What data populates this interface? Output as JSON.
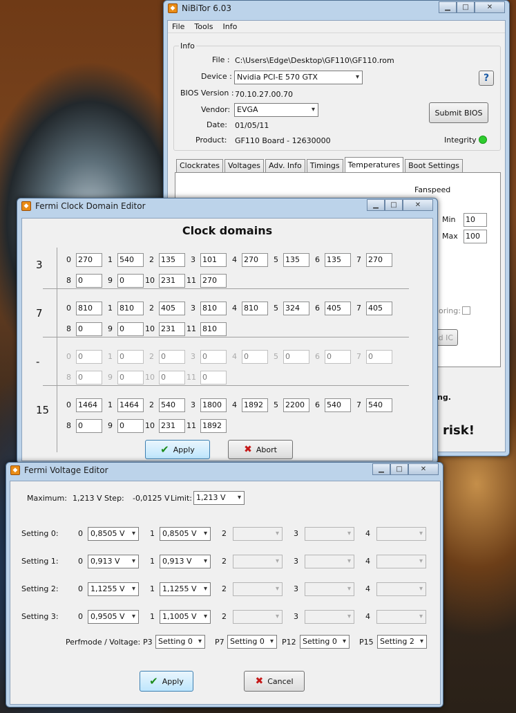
{
  "nibitor": {
    "title": "NiBiTor 6.03",
    "menu": [
      "File",
      "Tools",
      "Info"
    ],
    "info_group": "Info",
    "file_label": "File :",
    "file_value": "C:\\Users\\Edge\\Desktop\\GF110\\GF110.rom",
    "device_label": "Device :",
    "device_value": "Nvidia PCI-E 570 GTX",
    "help_icon": "?",
    "bios_label": "BIOS Version :",
    "bios_value": "70.10.27.00.70",
    "vendor_label": "Vendor:",
    "vendor_value": "EVGA",
    "submit_bios": "Submit BIOS",
    "date_label": "Date:",
    "date_value": "01/05/11",
    "product_label": "Product:",
    "product_value": "GF110 Board - 12630000",
    "integrity_label": "Integrity :",
    "integrity_color": "#2ecc2e",
    "tabs": [
      "Clockrates",
      "Voltages",
      "Adv. Info",
      "Timings",
      "Temperatures",
      "Boot Settings"
    ],
    "fanspeed": "Fanspeed",
    "min_label": "Min",
    "min_value": "10",
    "max_label": "Max",
    "max_value": "100",
    "monitoring_partial": "oring:",
    "ic_partial": "d IC",
    "ng_partial": "ng.",
    "risk_partial": "risk!"
  },
  "clock": {
    "title": "Fermi Clock Domain Editor",
    "heading": "Clock domains",
    "rows": [
      {
        "label": "3",
        "enabled": true,
        "values": [
          "270",
          "540",
          "135",
          "101",
          "270",
          "135",
          "135",
          "270",
          "0",
          "0",
          "231",
          "270"
        ]
      },
      {
        "label": "7",
        "enabled": true,
        "values": [
          "810",
          "810",
          "405",
          "810",
          "810",
          "324",
          "405",
          "405",
          "0",
          "0",
          "231",
          "810"
        ]
      },
      {
        "label": "-",
        "enabled": false,
        "values": [
          "0",
          "0",
          "0",
          "0",
          "0",
          "0",
          "0",
          "0",
          "0",
          "0",
          "0",
          "0"
        ]
      },
      {
        "label": "15",
        "enabled": true,
        "values": [
          "1464",
          "1464",
          "540",
          "1800",
          "1892",
          "2200",
          "540",
          "540",
          "0",
          "0",
          "231",
          "1892"
        ]
      }
    ],
    "indices": [
      "0",
      "1",
      "2",
      "3",
      "4",
      "5",
      "6",
      "7",
      "8",
      "9",
      "10",
      "11"
    ],
    "apply": "Apply",
    "abort": "Abort"
  },
  "voltage": {
    "title": "Fermi Voltage Editor",
    "maximum_label": "Maximum:",
    "maximum_value": "1,213 V",
    "step_label": "Step:",
    "step_value": "-0,0125 V",
    "limit_label": "Limit:",
    "limit_value": "1,213 V",
    "settings": [
      {
        "label": "Setting 0:",
        "v0": "0,8505 V",
        "v1": "0,8505 V"
      },
      {
        "label": "Setting 1:",
        "v0": "0,913 V",
        "v1": "0,913 V"
      },
      {
        "label": "Setting 2:",
        "v0": "1,1255 V",
        "v1": "1,1255 V"
      },
      {
        "label": "Setting 3:",
        "v0": "0,9505 V",
        "v1": "1,1005 V"
      }
    ],
    "slot_labels": [
      "0",
      "1",
      "2",
      "3",
      "4"
    ],
    "perf_label": "Perfmode / Voltage:",
    "perf": [
      {
        "p": "P3",
        "v": "Setting 0"
      },
      {
        "p": "P7",
        "v": "Setting 0"
      },
      {
        "p": "P12",
        "v": "Setting 0"
      },
      {
        "p": "P15",
        "v": "Setting 2"
      }
    ],
    "apply": "Apply",
    "cancel": "Cancel"
  }
}
